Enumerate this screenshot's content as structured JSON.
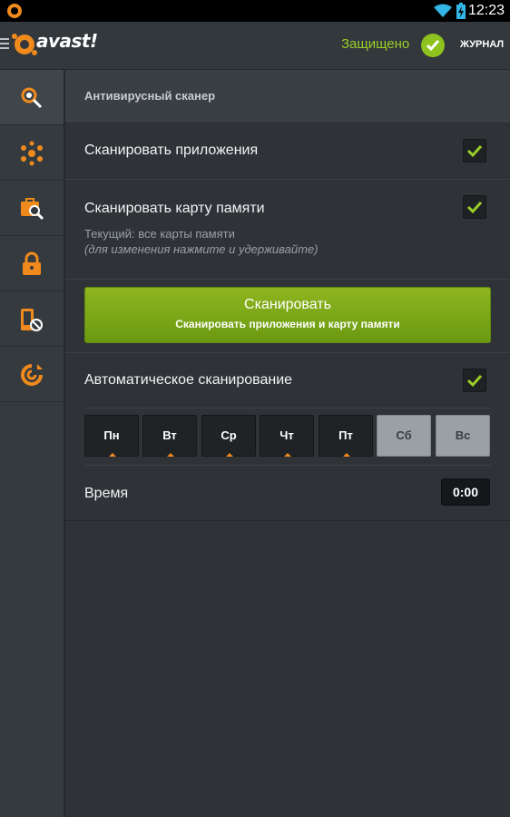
{
  "status_bar": {
    "time": "12:23"
  },
  "app": {
    "logo_text": "avast!"
  },
  "header": {
    "protected_label": "Защищено",
    "journal_label": "ЖУРНАЛ",
    "accent": "#8dc21f"
  },
  "sidebar": {
    "items": [
      {
        "icon": "antivirus-scan-icon",
        "active": true
      },
      {
        "icon": "network-meter-icon",
        "active": false
      },
      {
        "icon": "privacy-advisor-icon",
        "active": false
      },
      {
        "icon": "app-locker-icon",
        "active": false
      },
      {
        "icon": "anti-theft-icon",
        "active": false
      },
      {
        "icon": "firewall-icon",
        "active": false
      }
    ]
  },
  "main": {
    "section_title": "Антивирусный сканер",
    "scan_apps_label": "Сканировать приложения",
    "scan_apps_checked": true,
    "scan_card_label": "Сканировать карту памяти",
    "scan_card_checked": true,
    "card_current": "Текущий: все карты памяти",
    "card_hint": "(для изменения нажмите и удерживайте)",
    "scan_button_title": "Сканировать",
    "scan_button_subtitle": "Сканировать приложения и карту памяти",
    "auto_scan_label": "Автоматическое сканирование",
    "auto_scan_checked": true,
    "days": [
      {
        "label": "Пн",
        "on": true
      },
      {
        "label": "Вт",
        "on": true
      },
      {
        "label": "Ср",
        "on": true
      },
      {
        "label": "Чт",
        "on": true
      },
      {
        "label": "Пт",
        "on": true
      },
      {
        "label": "Сб",
        "on": false
      },
      {
        "label": "Вс",
        "on": false
      }
    ],
    "time_label": "Время",
    "time_value": "0:00"
  },
  "colors": {
    "orange": "#f08a1c",
    "green": "#8dc21f",
    "button_green": "#7aa817"
  }
}
